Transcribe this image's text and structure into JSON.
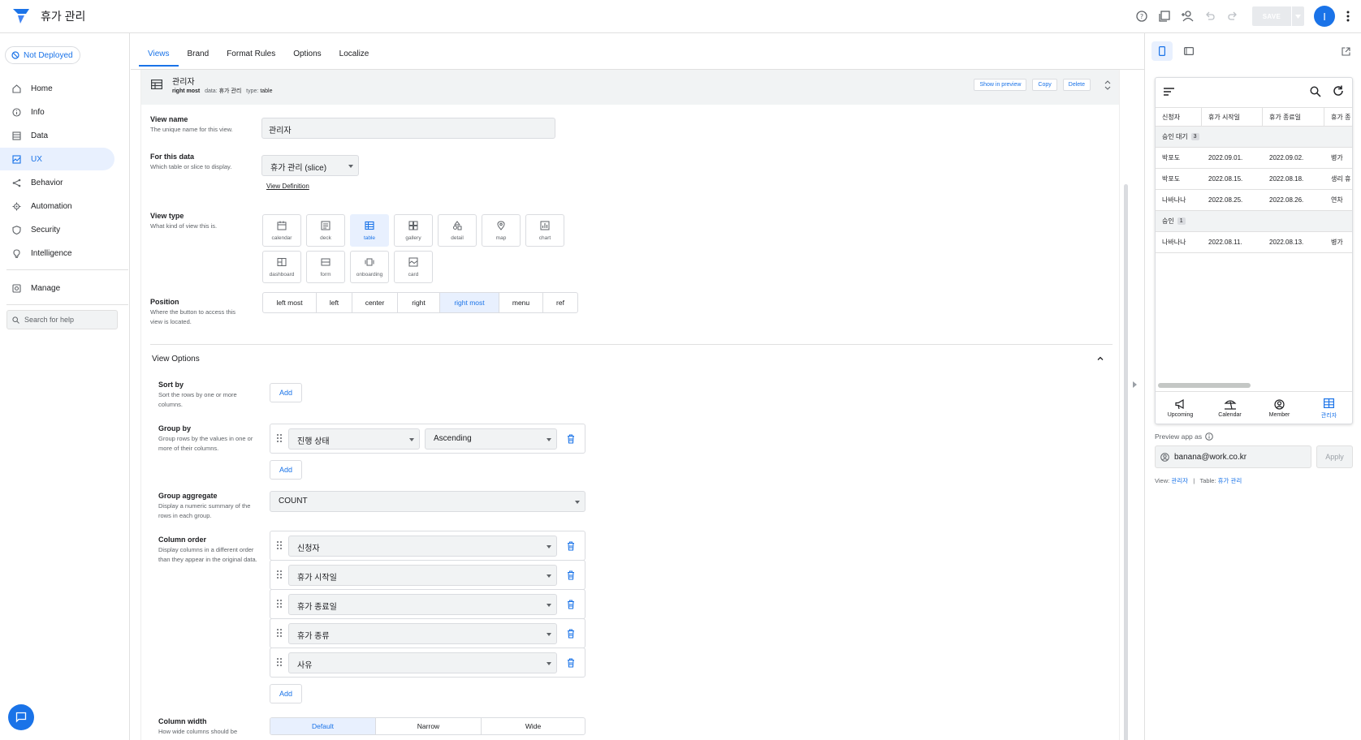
{
  "app": {
    "title": "휴가 관리",
    "save_label": "SAVE",
    "avatar_initial": "I",
    "accent": "#1a73e8"
  },
  "sidebar": {
    "deploy_status": "Not Deployed",
    "items": [
      {
        "label": "Home",
        "icon": "home-icon"
      },
      {
        "label": "Info",
        "icon": "info-icon"
      },
      {
        "label": "Data",
        "icon": "data-icon"
      },
      {
        "label": "UX",
        "icon": "ux-icon",
        "active": true
      },
      {
        "label": "Behavior",
        "icon": "behavior-icon"
      },
      {
        "label": "Automation",
        "icon": "automation-icon"
      },
      {
        "label": "Security",
        "icon": "shield-icon"
      },
      {
        "label": "Intelligence",
        "icon": "lightbulb-icon"
      }
    ],
    "manage_label": "Manage",
    "search_placeholder": "Search for help"
  },
  "tabs": [
    "Views",
    "Brand",
    "Format Rules",
    "Options",
    "Localize"
  ],
  "view_header": {
    "title": "관리자",
    "position": "right most",
    "data_label": "data:",
    "data_value": "휴가 관리",
    "type_label": "type:",
    "type_value": "table",
    "show_in_preview": "Show in preview",
    "copy": "Copy",
    "delete": "Delete"
  },
  "form": {
    "view_name": {
      "label": "View name",
      "desc": "The unique name for this view.",
      "value": "관리자"
    },
    "for_this_data": {
      "label": "For this data",
      "desc": "Which table or slice to display.",
      "value": "휴가 관리 (slice)",
      "link": "View Definition"
    },
    "view_type": {
      "label": "View type",
      "desc": "What kind of view this is.",
      "options": [
        "calendar",
        "deck",
        "table",
        "gallery",
        "detail",
        "map",
        "chart",
        "dashboard",
        "form",
        "onboarding",
        "card"
      ],
      "selected": "table"
    },
    "position": {
      "label": "Position",
      "desc": "Where the button to access this view is located.",
      "options": [
        "left most",
        "left",
        "center",
        "right",
        "right most",
        "menu",
        "ref"
      ],
      "selected": "right most"
    },
    "view_options_title": "View Options",
    "sort_by": {
      "label": "Sort by",
      "desc": "Sort the rows by one or more columns.",
      "add": "Add"
    },
    "group_by": {
      "label": "Group by",
      "desc": "Group rows by the values in one or more of their columns.",
      "column": "진행 상태",
      "order": "Ascending",
      "add": "Add"
    },
    "group_aggregate": {
      "label": "Group aggregate",
      "desc": "Display a numeric summary of the rows in each group.",
      "value": "COUNT"
    },
    "column_order": {
      "label": "Column order",
      "desc": "Display columns in a different order than they appear in the original data.",
      "columns": [
        "신청자",
        "휴가 시작일",
        "휴가 종료일",
        "휴가 종류",
        "사유"
      ],
      "add": "Add"
    },
    "column_width": {
      "label": "Column width",
      "desc": "How wide columns should be",
      "options": [
        "Default",
        "Narrow",
        "Wide"
      ],
      "selected": "Default"
    }
  },
  "preview": {
    "table_headers": [
      "신청자",
      "휴가 시작일",
      "휴가 종료일",
      "휴가 종"
    ],
    "groups": [
      {
        "name": "승인 대기",
        "count": "3",
        "rows": [
          [
            "박포도",
            "2022.09.01.",
            "2022.09.02.",
            "병가"
          ],
          [
            "박포도",
            "2022.08.15.",
            "2022.08.18.",
            "생리 휴"
          ],
          [
            "나바나나",
            "2022.08.25.",
            "2022.08.26.",
            "연차"
          ]
        ]
      },
      {
        "name": "승인",
        "count": "1",
        "rows": [
          [
            "나바나나",
            "2022.08.11.",
            "2022.08.13.",
            "병가"
          ]
        ]
      }
    ],
    "nav": [
      {
        "label": "Upcoming",
        "icon": "megaphone-icon"
      },
      {
        "label": "Calendar",
        "icon": "beach-icon"
      },
      {
        "label": "Member",
        "icon": "member-icon"
      },
      {
        "label": "관리자",
        "icon": "table-icon",
        "active": true
      }
    ],
    "preview_as_label": "Preview app as",
    "email": "banana@work.co.kr",
    "apply": "Apply",
    "view_label": "View:",
    "view_value": "관리자",
    "table_label": "Table:",
    "table_value": "휴가 관리"
  }
}
